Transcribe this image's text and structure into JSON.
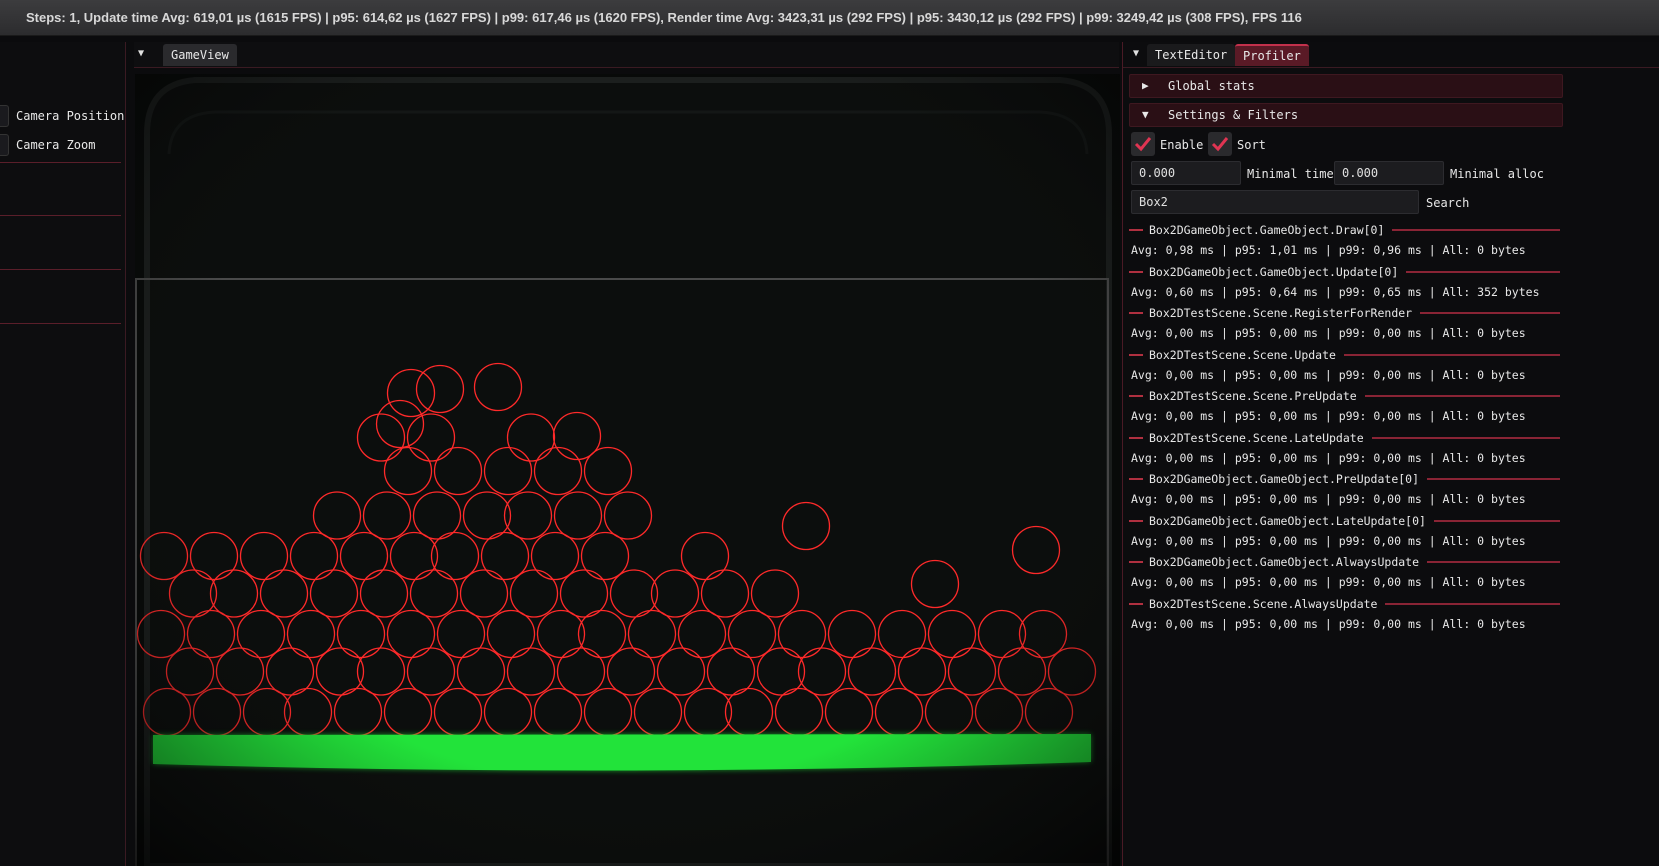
{
  "titlebar": {
    "text": "Steps: 1, Update time Avg: 619,01 µs (1615 FPS) | p95: 614,62 µs (1627 FPS) | p99: 617,46 µs (1620 FPS), Render time Avg: 3423,31 µs (292 FPS) | p95: 3430,12 µs (292 FPS) | p99: 3249,42 µs (308 FPS), FPS 116"
  },
  "left_panel": {
    "items": [
      {
        "label": "Camera Position"
      },
      {
        "label": "Camera Zoom"
      }
    ]
  },
  "game_view": {
    "tab_label": "GameView",
    "colors": {
      "ball": "#ff2a2a",
      "ground": "#22e33a",
      "border": "#5a5a5a"
    }
  },
  "right_panel": {
    "tabs": [
      "TextEditor",
      "Profiler"
    ],
    "active_tab": "Profiler",
    "headers": [
      {
        "label": "Global stats",
        "expanded": false
      },
      {
        "label": "Settings & Filters",
        "expanded": true
      }
    ],
    "checkboxes": [
      {
        "label": "Enable",
        "checked": true
      },
      {
        "label": "Sort",
        "checked": true
      }
    ],
    "min_time": {
      "value": "0.000",
      "label": "Minimal time"
    },
    "min_alloc": {
      "value": "0.000",
      "label": "Minimal alloc"
    },
    "search": {
      "value": "Box2",
      "label": "Search"
    },
    "entries": [
      {
        "name": "Box2DGameObject.GameObject.Draw[0]",
        "stats": "Avg: 0,98 ms | p95: 1,01 ms | p99: 0,96 ms | All: 0 bytes"
      },
      {
        "name": "Box2DGameObject.GameObject.Update[0]",
        "stats": "Avg: 0,60 ms | p95: 0,64 ms | p99: 0,65 ms | All: 352 bytes"
      },
      {
        "name": "Box2DTestScene.Scene.RegisterForRender",
        "stats": "Avg: 0,00 ms | p95: 0,00 ms | p99: 0,00 ms | All: 0 bytes"
      },
      {
        "name": "Box2DTestScene.Scene.Update",
        "stats": "Avg: 0,00 ms | p95: 0,00 ms | p99: 0,00 ms | All: 0 bytes"
      },
      {
        "name": "Box2DTestScene.Scene.PreUpdate",
        "stats": "Avg: 0,00 ms | p95: 0,00 ms | p99: 0,00 ms | All: 0 bytes"
      },
      {
        "name": "Box2DTestScene.Scene.LateUpdate",
        "stats": "Avg: 0,00 ms | p95: 0,00 ms | p99: 0,00 ms | All: 0 bytes"
      },
      {
        "name": "Box2DGameObject.GameObject.PreUpdate[0]",
        "stats": "Avg: 0,00 ms | p95: 0,00 ms | p99: 0,00 ms | All: 0 bytes"
      },
      {
        "name": "Box2DGameObject.GameObject.LateUpdate[0]",
        "stats": "Avg: 0,00 ms | p95: 0,00 ms | p99: 0,00 ms | All: 0 bytes"
      },
      {
        "name": "Box2DGameObject.GameObject.AlwaysUpdate",
        "stats": "Avg: 0,00 ms | p95: 0,00 ms | p99: 0,00 ms | All: 0 bytes"
      },
      {
        "name": "Box2DTestScene.Scene.AlwaysUpdate",
        "stats": "Avg: 0,00 ms | p95: 0,00 ms | p99: 0,00 ms | All: 0 bytes"
      }
    ]
  }
}
